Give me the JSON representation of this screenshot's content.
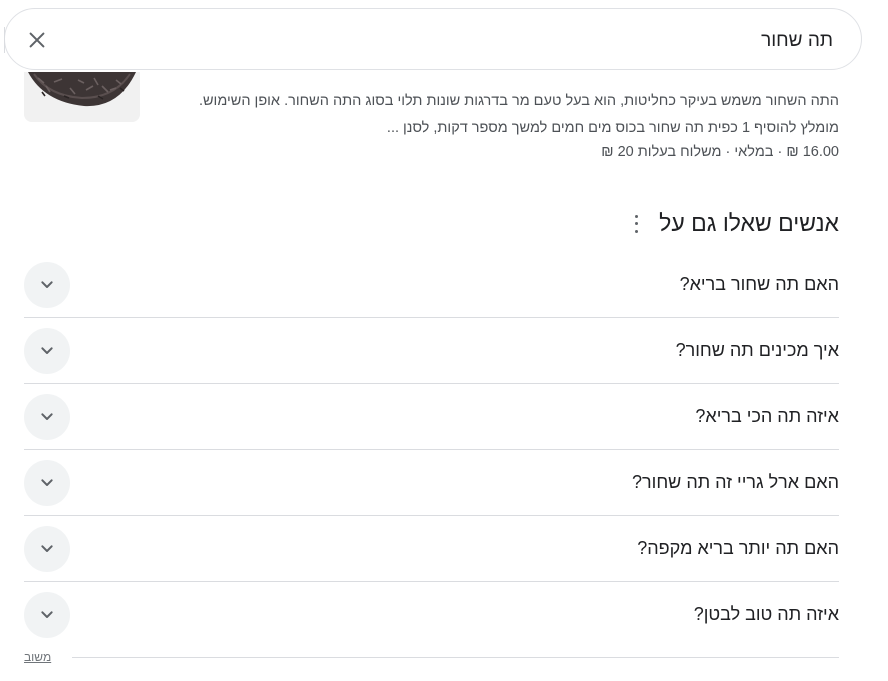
{
  "search": {
    "query": "תה שחור",
    "clear_icon": "close-icon"
  },
  "result": {
    "thumbnail": "black-tea-leaves-image",
    "snippet": "התה השחור משמש בעיקר כחליטות, הוא בעל טעם מר בדרגות שונות תלוי בסוג התה השחור. אופן השימוש. מומלץ להוסיף 1 כפית תה שחור בכוס מים חמים למשך מספר דקות, לסנן ...",
    "price": "16.00 ₪",
    "sep1": "·",
    "stock": "במלאי",
    "sep2": "·",
    "shipping": "משלוח בעלות 20 ₪"
  },
  "paa": {
    "title": "אנשים שאלו גם על",
    "more_icon": "more-vert-icon",
    "questions": [
      "האם תה שחור בריא?",
      "איך מכינים תה שחור?",
      "איזה תה הכי בריא?",
      "האם ארל גריי זה תה שחור?",
      "האם תה יותר בריא מקפה?",
      "איזה תה טוב לבטן?"
    ],
    "expand_icon": "chevron-down-icon"
  },
  "feedback": {
    "label": "משוב"
  }
}
